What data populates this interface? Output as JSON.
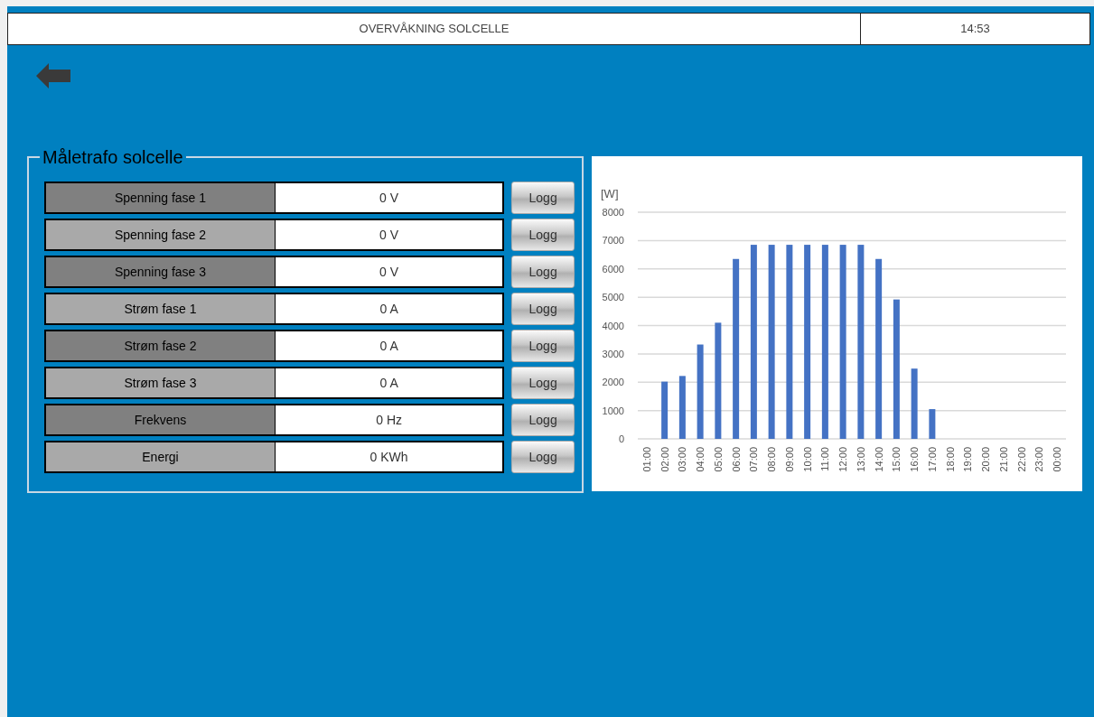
{
  "header": {
    "title": "OVERVÅKNING SOLCELLE",
    "time": "14:53"
  },
  "panel": {
    "legend": "Måletrafo solcelle",
    "rows": [
      {
        "label": "Spenning fase 1",
        "value": "0 V",
        "button": "Logg",
        "color": "#808080"
      },
      {
        "label": "Spenning fase 2",
        "value": "0 V",
        "button": "Logg",
        "color": "#a9a9a9"
      },
      {
        "label": "Spenning fase 3",
        "value": "0 V",
        "button": "Logg",
        "color": "#808080"
      },
      {
        "label": "Strøm fase 1",
        "value": "0 A",
        "button": "Logg",
        "color": "#a9a9a9"
      },
      {
        "label": "Strøm fase 2",
        "value": "0 A",
        "button": "Logg",
        "color": "#808080"
      },
      {
        "label": "Strøm fase 3",
        "value": "0 A",
        "button": "Logg",
        "color": "#a9a9a9"
      },
      {
        "label": "Frekvens",
        "value": "0 Hz",
        "button": "Logg",
        "color": "#808080"
      },
      {
        "label": "Energi",
        "value": "0 KWh",
        "button": "Logg",
        "color": "#a9a9a9"
      }
    ]
  },
  "chart": {
    "chart_data": {
      "type": "bar",
      "ylabel": "[W]",
      "categories": [
        "01:00",
        "02:00",
        "03:00",
        "04:00",
        "05:00",
        "06:00",
        "07:00",
        "08:00",
        "09:00",
        "10:00",
        "11:00",
        "12:00",
        "13:00",
        "14:00",
        "15:00",
        "16:00",
        "17:00",
        "18:00",
        "19:00",
        "20:00",
        "21:00",
        "22:00",
        "23:00",
        "00:00"
      ],
      "grid": true,
      "series": [
        {
          "color": "#4472c4",
          "values": [
            0,
            2020,
            2220,
            3330,
            4100,
            6350,
            6850,
            6850,
            6850,
            6850,
            6850,
            6850,
            6850,
            6350,
            4920,
            2480,
            1050,
            0,
            0,
            0,
            0,
            0,
            0,
            0
          ]
        }
      ],
      "ylim": [
        0,
        8000
      ],
      "yticks": [
        0,
        1000,
        2000,
        3000,
        4000,
        5000,
        6000,
        7000,
        8000
      ]
    }
  }
}
